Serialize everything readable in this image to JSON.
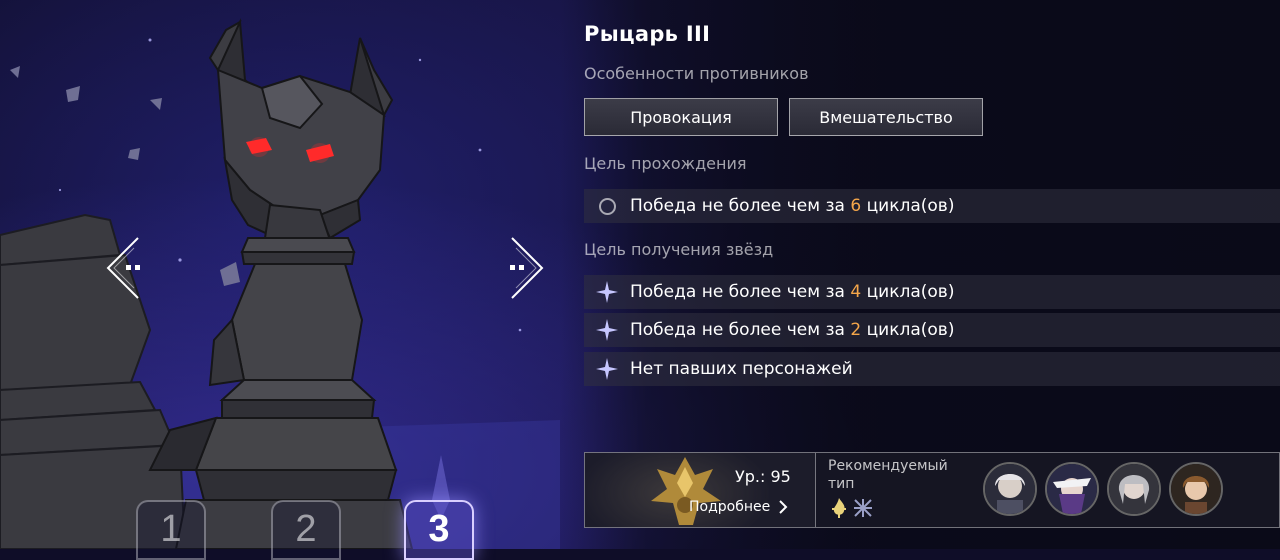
{
  "title": "Рыцарь III",
  "sections": {
    "enemy_features_label": "Особенности противников",
    "clear_goal_label": "Цель прохождения",
    "star_goal_label": "Цель получения звёзд"
  },
  "features": [
    "Провокация",
    "Вмешательство"
  ],
  "clear_goal": {
    "prefix": "Победа не более чем за ",
    "number": "6",
    "suffix": " цикла(ов)"
  },
  "star_goals": [
    {
      "prefix": "Победа не более чем за ",
      "number": "4",
      "suffix": " цикла(ов)"
    },
    {
      "prefix": "Победа не более чем за ",
      "number": "2",
      "suffix": " цикла(ов)"
    },
    {
      "prefix": "Нет павших персонажей",
      "number": "",
      "suffix": ""
    }
  ],
  "stages": [
    "1",
    "2",
    "3"
  ],
  "active_stage": "3",
  "boss": {
    "level": "Ур.: 95",
    "details_label": "Подробнее"
  },
  "recommended": {
    "label": "Рекомендуемый тип"
  },
  "icons": {
    "nav_left": "chevron-left-icon",
    "nav_right": "chevron-right-icon",
    "clear_goal": "circle-icon",
    "star_goal": "star-icon",
    "details": "chevron-right-icon",
    "rec_types": [
      "fire-icon",
      "quantum-icon"
    ]
  },
  "colors": {
    "accent_number": "#f4a64a",
    "active_stage": "#d9cfff"
  }
}
